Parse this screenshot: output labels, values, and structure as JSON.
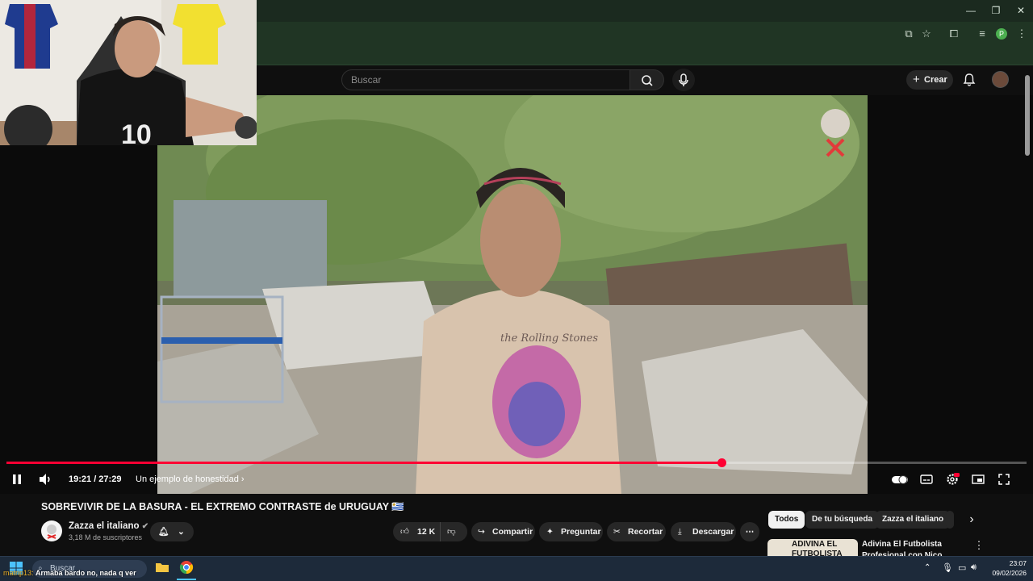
{
  "browser": {
    "window_controls": [
      "—",
      "❐",
      "✕"
    ],
    "profile_initial": "P"
  },
  "header": {
    "search_placeholder": "Buscar",
    "create_label": "Crear"
  },
  "player": {
    "time": "19:21 / 27:29",
    "chapter": "Un ejemplo de honestidad",
    "progress": 0.701,
    "shirt_text": "the Rolling Stones"
  },
  "video": {
    "title": "SOBREVIVIR DE LA BASURA - EL EXTREMO CONTRASTE de URUGUAY 🇺🇾",
    "channel": "Zazza el italiano",
    "subscribers": "3,18 M de suscriptores",
    "likes": "12 K",
    "share": "Compartir",
    "ask": "Preguntar",
    "clip": "Recortar",
    "download": "Descargar"
  },
  "sidebar": {
    "chips": [
      "Todos",
      "De tu búsqueda",
      "Zazza el italiano"
    ],
    "rec_title": "Adivina El Futbolista Profesional con Nico Williams",
    "rec_thumb_text": "ADIVINA EL FUTBOLISTA"
  },
  "taskbar": {
    "search": "Buscar",
    "chat_user": "matrip13",
    "chat_message": "Armaba bardo no, nada q ver",
    "time": "23:07",
    "date": "09/02/2026"
  },
  "colors": {
    "accent": "#ff0033",
    "chrome": "#203524"
  }
}
